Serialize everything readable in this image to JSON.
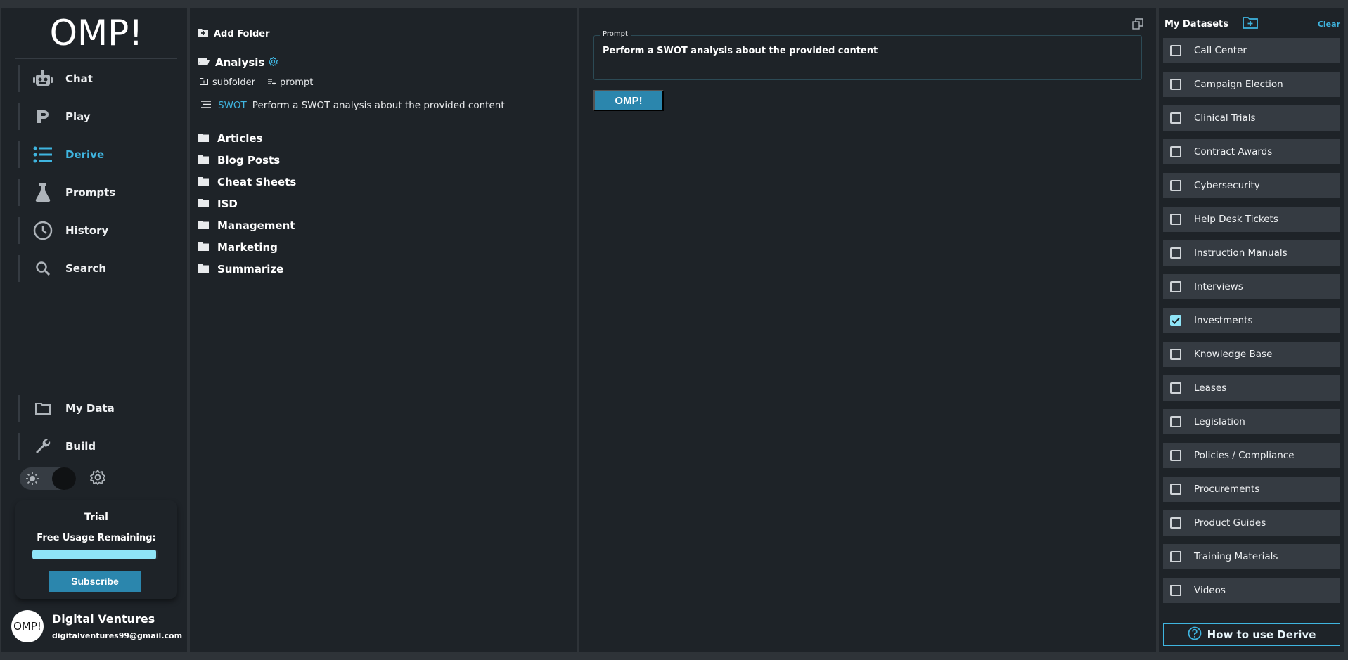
{
  "app": {
    "logo": "OMP!"
  },
  "nav": {
    "items": [
      {
        "label": "Chat",
        "icon": "robot-icon"
      },
      {
        "label": "Play",
        "icon": "p-icon"
      },
      {
        "label": "Derive",
        "icon": "list-icon",
        "active": true
      },
      {
        "label": "Prompts",
        "icon": "flask-icon"
      },
      {
        "label": "History",
        "icon": "clock-icon"
      },
      {
        "label": "Search",
        "icon": "search-icon"
      }
    ],
    "bottom_items": [
      {
        "label": "My Data",
        "icon": "folder-icon"
      },
      {
        "label": "Build",
        "icon": "wrench-icon"
      }
    ]
  },
  "trial": {
    "title": "Trial",
    "usage_label": "Free Usage Remaining:",
    "usage_fraction": 0.99,
    "subscribe_label": "Subscribe"
  },
  "user": {
    "avatar_text": "OMP!",
    "name": "Digital Ventures",
    "email": "digitalventures99@gmail.com"
  },
  "folders": {
    "add_folder_label": "Add Folder",
    "open_folder": "Analysis",
    "sub_actions": {
      "subfolder": "subfolder",
      "prompt": "prompt"
    },
    "prompt_item": {
      "name": "SWOT",
      "text": "Perform a SWOT analysis about the provided content"
    },
    "list": [
      "Articles",
      "Blog Posts",
      "Cheat Sheets",
      "ISD",
      "Management",
      "Marketing",
      "Summarize"
    ]
  },
  "main": {
    "prompt_label": "Prompt",
    "prompt_text": "Perform a SWOT analysis about the provided content",
    "omp_button": "OMP!"
  },
  "datasets": {
    "title": "My Datasets",
    "clear_label": "Clear",
    "items": [
      {
        "label": "Call Center",
        "checked": false
      },
      {
        "label": "Campaign Election",
        "checked": false
      },
      {
        "label": "Clinical Trials",
        "checked": false
      },
      {
        "label": "Contract Awards",
        "checked": false
      },
      {
        "label": "Cybersecurity",
        "checked": false
      },
      {
        "label": "Help Desk Tickets",
        "checked": false
      },
      {
        "label": "Instruction Manuals",
        "checked": false
      },
      {
        "label": "Interviews",
        "checked": false
      },
      {
        "label": "Investments",
        "checked": true
      },
      {
        "label": "Knowledge Base",
        "checked": false
      },
      {
        "label": "Leases",
        "checked": false
      },
      {
        "label": "Legislation",
        "checked": false
      },
      {
        "label": "Policies / Compliance",
        "checked": false
      },
      {
        "label": "Procurements",
        "checked": false
      },
      {
        "label": "Product Guides",
        "checked": false
      },
      {
        "label": "Training Materials",
        "checked": false
      },
      {
        "label": "Videos",
        "checked": false
      }
    ],
    "help_label": "How to use Derive"
  },
  "colors": {
    "accent": "#3fb5e0",
    "button": "#2b86ad",
    "panel": "#1e2328",
    "item": "#353b42"
  }
}
